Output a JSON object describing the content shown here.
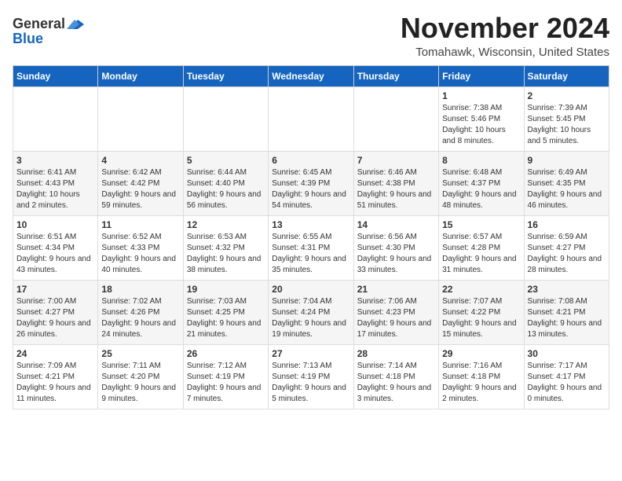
{
  "logo": {
    "line1": "General",
    "line2": "Blue"
  },
  "title": "November 2024",
  "subtitle": "Tomahawk, Wisconsin, United States",
  "days_of_week": [
    "Sunday",
    "Monday",
    "Tuesday",
    "Wednesday",
    "Thursday",
    "Friday",
    "Saturday"
  ],
  "weeks": [
    [
      {
        "day": "",
        "info": ""
      },
      {
        "day": "",
        "info": ""
      },
      {
        "day": "",
        "info": ""
      },
      {
        "day": "",
        "info": ""
      },
      {
        "day": "",
        "info": ""
      },
      {
        "day": "1",
        "info": "Sunrise: 7:38 AM\nSunset: 5:46 PM\nDaylight: 10 hours and 8 minutes."
      },
      {
        "day": "2",
        "info": "Sunrise: 7:39 AM\nSunset: 5:45 PM\nDaylight: 10 hours and 5 minutes."
      }
    ],
    [
      {
        "day": "3",
        "info": "Sunrise: 6:41 AM\nSunset: 4:43 PM\nDaylight: 10 hours and 2 minutes."
      },
      {
        "day": "4",
        "info": "Sunrise: 6:42 AM\nSunset: 4:42 PM\nDaylight: 9 hours and 59 minutes."
      },
      {
        "day": "5",
        "info": "Sunrise: 6:44 AM\nSunset: 4:40 PM\nDaylight: 9 hours and 56 minutes."
      },
      {
        "day": "6",
        "info": "Sunrise: 6:45 AM\nSunset: 4:39 PM\nDaylight: 9 hours and 54 minutes."
      },
      {
        "day": "7",
        "info": "Sunrise: 6:46 AM\nSunset: 4:38 PM\nDaylight: 9 hours and 51 minutes."
      },
      {
        "day": "8",
        "info": "Sunrise: 6:48 AM\nSunset: 4:37 PM\nDaylight: 9 hours and 48 minutes."
      },
      {
        "day": "9",
        "info": "Sunrise: 6:49 AM\nSunset: 4:35 PM\nDaylight: 9 hours and 46 minutes."
      }
    ],
    [
      {
        "day": "10",
        "info": "Sunrise: 6:51 AM\nSunset: 4:34 PM\nDaylight: 9 hours and 43 minutes."
      },
      {
        "day": "11",
        "info": "Sunrise: 6:52 AM\nSunset: 4:33 PM\nDaylight: 9 hours and 40 minutes."
      },
      {
        "day": "12",
        "info": "Sunrise: 6:53 AM\nSunset: 4:32 PM\nDaylight: 9 hours and 38 minutes."
      },
      {
        "day": "13",
        "info": "Sunrise: 6:55 AM\nSunset: 4:31 PM\nDaylight: 9 hours and 35 minutes."
      },
      {
        "day": "14",
        "info": "Sunrise: 6:56 AM\nSunset: 4:30 PM\nDaylight: 9 hours and 33 minutes."
      },
      {
        "day": "15",
        "info": "Sunrise: 6:57 AM\nSunset: 4:28 PM\nDaylight: 9 hours and 31 minutes."
      },
      {
        "day": "16",
        "info": "Sunrise: 6:59 AM\nSunset: 4:27 PM\nDaylight: 9 hours and 28 minutes."
      }
    ],
    [
      {
        "day": "17",
        "info": "Sunrise: 7:00 AM\nSunset: 4:27 PM\nDaylight: 9 hours and 26 minutes."
      },
      {
        "day": "18",
        "info": "Sunrise: 7:02 AM\nSunset: 4:26 PM\nDaylight: 9 hours and 24 minutes."
      },
      {
        "day": "19",
        "info": "Sunrise: 7:03 AM\nSunset: 4:25 PM\nDaylight: 9 hours and 21 minutes."
      },
      {
        "day": "20",
        "info": "Sunrise: 7:04 AM\nSunset: 4:24 PM\nDaylight: 9 hours and 19 minutes."
      },
      {
        "day": "21",
        "info": "Sunrise: 7:06 AM\nSunset: 4:23 PM\nDaylight: 9 hours and 17 minutes."
      },
      {
        "day": "22",
        "info": "Sunrise: 7:07 AM\nSunset: 4:22 PM\nDaylight: 9 hours and 15 minutes."
      },
      {
        "day": "23",
        "info": "Sunrise: 7:08 AM\nSunset: 4:21 PM\nDaylight: 9 hours and 13 minutes."
      }
    ],
    [
      {
        "day": "24",
        "info": "Sunrise: 7:09 AM\nSunset: 4:21 PM\nDaylight: 9 hours and 11 minutes."
      },
      {
        "day": "25",
        "info": "Sunrise: 7:11 AM\nSunset: 4:20 PM\nDaylight: 9 hours and 9 minutes."
      },
      {
        "day": "26",
        "info": "Sunrise: 7:12 AM\nSunset: 4:19 PM\nDaylight: 9 hours and 7 minutes."
      },
      {
        "day": "27",
        "info": "Sunrise: 7:13 AM\nSunset: 4:19 PM\nDaylight: 9 hours and 5 minutes."
      },
      {
        "day": "28",
        "info": "Sunrise: 7:14 AM\nSunset: 4:18 PM\nDaylight: 9 hours and 3 minutes."
      },
      {
        "day": "29",
        "info": "Sunrise: 7:16 AM\nSunset: 4:18 PM\nDaylight: 9 hours and 2 minutes."
      },
      {
        "day": "30",
        "info": "Sunrise: 7:17 AM\nSunset: 4:17 PM\nDaylight: 9 hours and 0 minutes."
      }
    ]
  ]
}
